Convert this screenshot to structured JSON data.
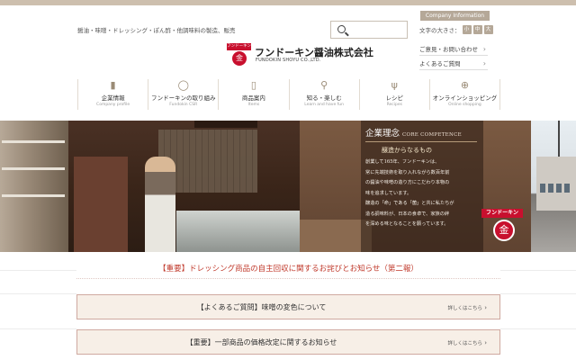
{
  "header": {
    "tagline": "醤油・味噌・ドレッシング・ぽん酢・他調味料の製造、販売",
    "company_info": "Company Information",
    "font_size_label": "文字の大きさ：",
    "font_sizes": [
      "小",
      "中",
      "大"
    ],
    "links": [
      "ご意見・お問い合わせ",
      "よくあるご質問"
    ],
    "search": {
      "placeholder": ""
    }
  },
  "logo": {
    "badge_text": "フンドーキン",
    "mark": "金",
    "name": "フンドーキン醤油株式会社",
    "sub": "FUNDOKIN SHOYU CO.,LTD."
  },
  "nav": [
    {
      "label": "企業情報",
      "sub": "Company profile",
      "icon": "bottle-icon"
    },
    {
      "label": "フンドーキンの取り組み",
      "sub": "Fundokin CSR",
      "icon": "leaf-icon"
    },
    {
      "label": "商品案内",
      "sub": "Items",
      "icon": "product-icon"
    },
    {
      "label": "知る・楽しむ",
      "sub": "Learn and have fun",
      "icon": "search-icon"
    },
    {
      "label": "レシピ",
      "sub": "Recipes",
      "icon": "fork-icon"
    },
    {
      "label": "オンラインショッピング",
      "sub": "Online shopping",
      "icon": "cart-icon"
    }
  ],
  "hero": {
    "title": "企業理念",
    "title_en": "CORE COMPETENCE",
    "subtitle": "醸造からなるもの",
    "body": [
      "創業して165年、フンドーキンは、",
      "常に先端技術を取り入れながら数百年前",
      "の醤油や味噌の造り方にこだわり本物の",
      "味を追求しています。",
      "醸造の「命」である「菌」と共に私たちが",
      "造る調味料が、日本の食卓で、家族の絆",
      "を深める味となることを願っています。"
    ],
    "badge_text": "フンドーキン",
    "badge_mark": "金"
  },
  "notices": {
    "red": "【重要】ドレッシング商品の自主回収に関するお詫びとお知らせ（第二報）",
    "more_label": "詳しくはこちら",
    "items": [
      "【よくあるご質問】味噌の変色について",
      "【重要】一部商品の価格改定に関するお知らせ"
    ]
  },
  "colors": {
    "brand_red": "#c8102e",
    "accent_beige": "#b5a898",
    "notice_red": "#c0392b",
    "news_bg": "#f7efe7"
  }
}
